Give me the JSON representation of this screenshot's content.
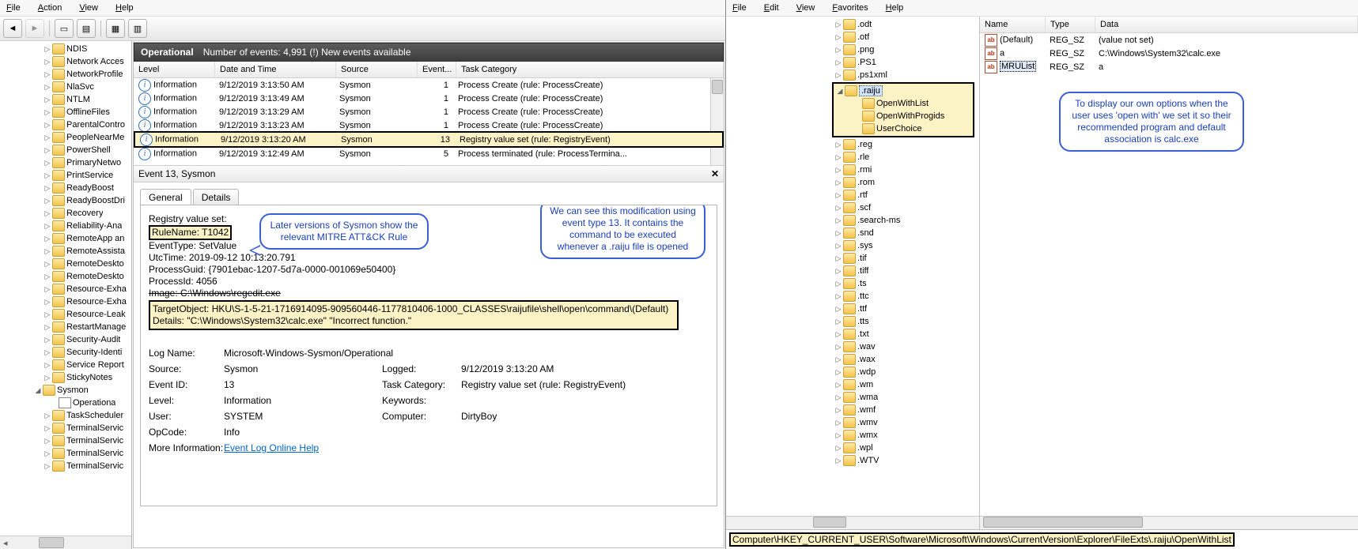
{
  "eventviewer": {
    "menu": [
      "File",
      "Action",
      "View",
      "Help"
    ],
    "toolbar_icons": [
      "back",
      "fwd",
      "up",
      "props",
      "find",
      "refresh",
      "help"
    ],
    "tree": [
      "NDIS",
      "Network Acces",
      "NetworkProfile",
      "NlaSvc",
      "NTLM",
      "OfflineFiles",
      "ParentalContro",
      "PeopleNearMe",
      "PowerShell",
      "PrimaryNetwo",
      "PrintService",
      "ReadyBoost",
      "ReadyBoostDri",
      "Recovery",
      "Reliability-Ana",
      "RemoteApp an",
      "RemoteAssista",
      "RemoteDeskto",
      "RemoteDeskto",
      "Resource-Exha",
      "Resource-Exha",
      "Resource-Leak",
      "RestartManage",
      "Security-Audit",
      "Security-Identi",
      "Service Report",
      "StickyNotes",
      "Sysmon",
      "TaskScheduler",
      "TerminalServic",
      "TerminalServic",
      "TerminalServic",
      "TerminalServic"
    ],
    "sysmon_child": "Operationa",
    "header": {
      "title": "Operational",
      "count": "Number of events: 4,991 (!) New events available"
    },
    "cols": {
      "level": "Level",
      "dt": "Date and Time",
      "src": "Source",
      "eid": "Event...",
      "tc": "Task Category"
    },
    "rows": [
      {
        "lvl": "Information",
        "dt": "9/12/2019 3:13:50 AM",
        "src": "Sysmon",
        "eid": "1",
        "tc": "Process Create (rule: ProcessCreate)"
      },
      {
        "lvl": "Information",
        "dt": "9/12/2019 3:13:49 AM",
        "src": "Sysmon",
        "eid": "1",
        "tc": "Process Create (rule: ProcessCreate)"
      },
      {
        "lvl": "Information",
        "dt": "9/12/2019 3:13:29 AM",
        "src": "Sysmon",
        "eid": "1",
        "tc": "Process Create (rule: ProcessCreate)"
      },
      {
        "lvl": "Information",
        "dt": "9/12/2019 3:13:23 AM",
        "src": "Sysmon",
        "eid": "1",
        "tc": "Process Create (rule: ProcessCreate)"
      },
      {
        "lvl": "Information",
        "dt": "9/12/2019 3:13:20 AM",
        "src": "Sysmon",
        "eid": "13",
        "tc": "Registry value set (rule: RegistryEvent)",
        "hl": true
      },
      {
        "lvl": "Information",
        "dt": "9/12/2019 3:12:49 AM",
        "src": "Sysmon",
        "eid": "5",
        "tc": "Process terminated (rule: ProcessTermina..."
      }
    ],
    "detail_title": "Event 13, Sysmon",
    "tabs": {
      "general": "General",
      "details": "Details"
    },
    "detail": {
      "l1": "Registry value set:",
      "rulename": "RuleName: T1042",
      "l3": "EventType: SetValue",
      "l4": "UtcTime: 2019-09-12 10:13:20.791",
      "l5": "ProcessGuid: {7901ebac-1207-5d7a-0000-001069e50400}",
      "l6": "ProcessId: 4056",
      "l7": "Image: C:\\Windows\\regedit.exe",
      "target": "TargetObject: HKU\\S-1-5-21-1716914095-909560446-1177810406-1000_CLASSES\\raijufile\\shell\\open\\command\\(Default)",
      "details": "Details: \"C:\\Windows\\System32\\calc.exe\" \"Incorrect function.\""
    },
    "low": {
      "logname_l": "Log Name:",
      "logname": "Microsoft-Windows-Sysmon/Operational",
      "source_l": "Source:",
      "source": "Sysmon",
      "logged_l": "Logged:",
      "logged": "9/12/2019 3:13:20 AM",
      "eid_l": "Event ID:",
      "eid": "13",
      "tc_l": "Task Category:",
      "tc": "Registry value set (rule: RegistryEvent)",
      "level_l": "Level:",
      "level": "Information",
      "kw_l": "Keywords:",
      "kw": "",
      "user_l": "User:",
      "user": "SYSTEM",
      "comp_l": "Computer:",
      "comp": "DirtyBoy",
      "op_l": "OpCode:",
      "op": "Info",
      "more_l": "More Information:",
      "more": "Event Log Online Help"
    },
    "callout1": "Later versions of Sysmon show the relevant MITRE ATT&CK Rule",
    "callout2": "We can see this modification using event type 13. It contains the command to be executed whenever a .raiju file is opened"
  },
  "regedit": {
    "menu": [
      "File",
      "Edit",
      "View",
      "Favorites",
      "Help"
    ],
    "exts": [
      ".odt",
      ".otf",
      ".png",
      ".PS1",
      ".ps1xml"
    ],
    "raiju": ".raiju",
    "raiju_children": [
      "OpenWithList",
      "OpenWithProgids",
      "UserChoice"
    ],
    "exts2": [
      ".reg",
      ".rle",
      ".rmi",
      ".rom",
      ".rtf",
      ".scf",
      ".search-ms",
      ".snd",
      ".sys",
      ".tif",
      ".tiff",
      ".ts",
      ".ttc",
      ".ttf",
      ".tts",
      ".txt",
      ".wav",
      ".wax",
      ".wdp",
      ".wm",
      ".wma",
      ".wmf",
      ".wmv",
      ".wmx",
      ".wpl",
      ".WTV"
    ],
    "cols": {
      "name": "Name",
      "type": "Type",
      "data": "Data"
    },
    "vals": [
      {
        "n": "(Default)",
        "t": "REG_SZ",
        "d": "(value not set)"
      },
      {
        "n": "a",
        "t": "REG_SZ",
        "d": "C:\\Windows\\System32\\calc.exe"
      },
      {
        "n": "MRUList",
        "t": "REG_SZ",
        "d": "a",
        "sel": true
      }
    ],
    "callout": "To display our own options when the user uses 'open with' we set it so their recommended program and default association is calc.exe",
    "status": "Computer\\HKEY_CURRENT_USER\\Software\\Microsoft\\Windows\\CurrentVersion\\Explorer\\FileExts\\.raiju\\OpenWithList"
  }
}
